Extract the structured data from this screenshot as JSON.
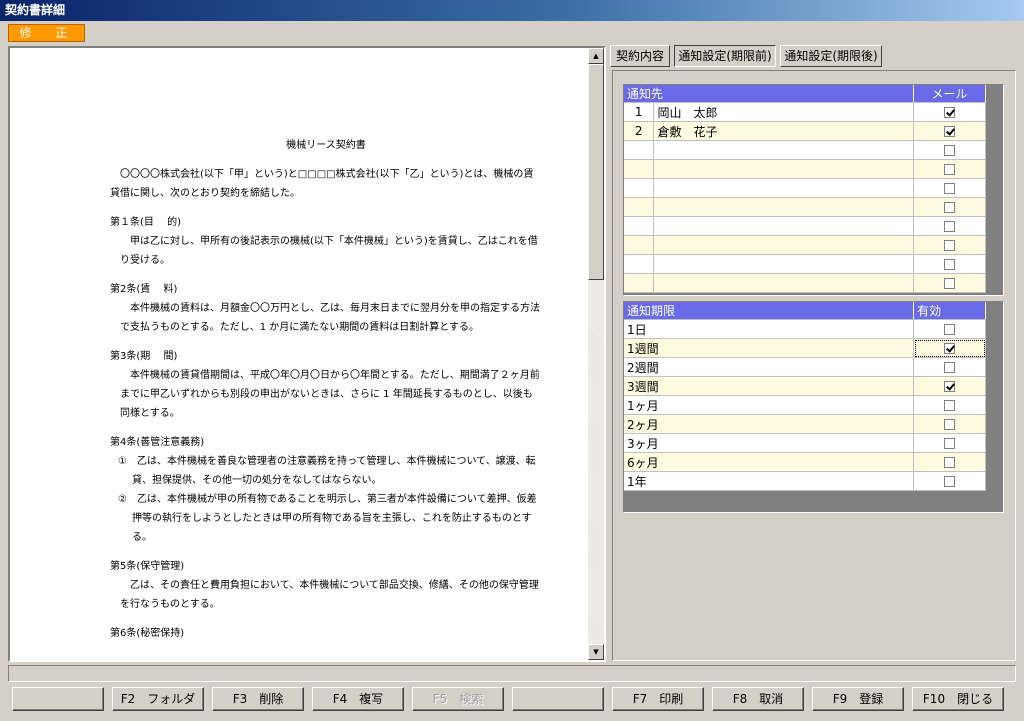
{
  "window": {
    "title": "契約書詳細"
  },
  "mode_badge": "修　正",
  "document": {
    "title": "機械リース契約書",
    "intro": "〇〇〇〇株式会社(以下「甲」という)と□□□□株式会社(以下「乙」という)とは、機械の賃貸借に関し、次のとおり契約を締結した。",
    "articles": [
      {
        "heading": "第１条(目　 的)",
        "body": "甲は乙に対し、甲所有の後記表示の機械(以下「本件機械」という)を賃貸し、乙はこれを借り受ける。"
      },
      {
        "heading": "第2条(賃　 料)",
        "body": "本件機械の賃料は、月額金〇〇万円とし、乙は、毎月末日までに翌月分を甲の指定する方法で支払うものとする。ただし、1 か月に満たない期間の賃料は日割計算とする。"
      },
      {
        "heading": "第3条(期　 間)",
        "body": "本件機械の賃貸借期間は、平成〇年〇月〇日から〇年間とする。ただし、期間満了２ヶ月前までに甲乙いずれからも別段の申出がないときは、さらに 1 年間延長するものとし、以後も同様とする。"
      },
      {
        "heading": "第4条(善管注意義務)",
        "items": [
          "①　乙は、本件機械を善良な管理者の注意義務を持って管理し、本件機械について、譲渡、転貸、担保提供、その他一切の処分をなしてはならない。",
          "②　乙は、本件機械が甲の所有物であることを明示し、第三者が本件設備について差押、仮差押等の執行をしようとしたときは甲の所有物である旨を主張し、これを防止するものとする。"
        ]
      },
      {
        "heading": "第5条(保守管理)",
        "body": "乙は、その責任と費用負担において、本件機械について部品交換、修繕、その他の保守管理を行なうものとする。"
      },
      {
        "heading": "第6条(秘密保持)",
        "body": ""
      }
    ]
  },
  "tabs": [
    {
      "label": "契約内容",
      "active": false
    },
    {
      "label": "通知設定(期限前)",
      "active": true
    },
    {
      "label": "通知設定(期限後)",
      "active": false
    }
  ],
  "recipients": {
    "col_name": "通知先",
    "col_mail": "メール",
    "rows": [
      {
        "no": "1",
        "name": "岡山　太郎",
        "mail": true
      },
      {
        "no": "2",
        "name": "倉敷　花子",
        "mail": true
      },
      {
        "no": "",
        "name": "",
        "mail": false
      },
      {
        "no": "",
        "name": "",
        "mail": false
      },
      {
        "no": "",
        "name": "",
        "mail": false
      },
      {
        "no": "",
        "name": "",
        "mail": false
      },
      {
        "no": "",
        "name": "",
        "mail": false
      },
      {
        "no": "",
        "name": "",
        "mail": false
      },
      {
        "no": "",
        "name": "",
        "mail": false
      },
      {
        "no": "",
        "name": "",
        "mail": false
      }
    ]
  },
  "deadlines": {
    "col_period": "通知期限",
    "col_enabled": "有効",
    "rows": [
      {
        "label": "1日",
        "enabled": false
      },
      {
        "label": "1週間",
        "enabled": true
      },
      {
        "label": "2週間",
        "enabled": false
      },
      {
        "label": "3週間",
        "enabled": true
      },
      {
        "label": "1ヶ月",
        "enabled": false
      },
      {
        "label": "2ヶ月",
        "enabled": false
      },
      {
        "label": "3ヶ月",
        "enabled": false
      },
      {
        "label": "6ヶ月",
        "enabled": false
      },
      {
        "label": "1年",
        "enabled": false
      }
    ]
  },
  "function_keys": [
    {
      "label": "",
      "enabled": true
    },
    {
      "label": "F2　フォルダ",
      "enabled": true
    },
    {
      "label": "F3　削除",
      "enabled": true
    },
    {
      "label": "F4　複写",
      "enabled": true
    },
    {
      "label": "F5　検索",
      "enabled": false
    },
    {
      "label": "",
      "enabled": true
    },
    {
      "label": "F7　印刷",
      "enabled": true
    },
    {
      "label": "F8　取消",
      "enabled": true
    },
    {
      "label": "F9　登録",
      "enabled": true
    },
    {
      "label": "F10　閉じる",
      "enabled": true
    }
  ]
}
